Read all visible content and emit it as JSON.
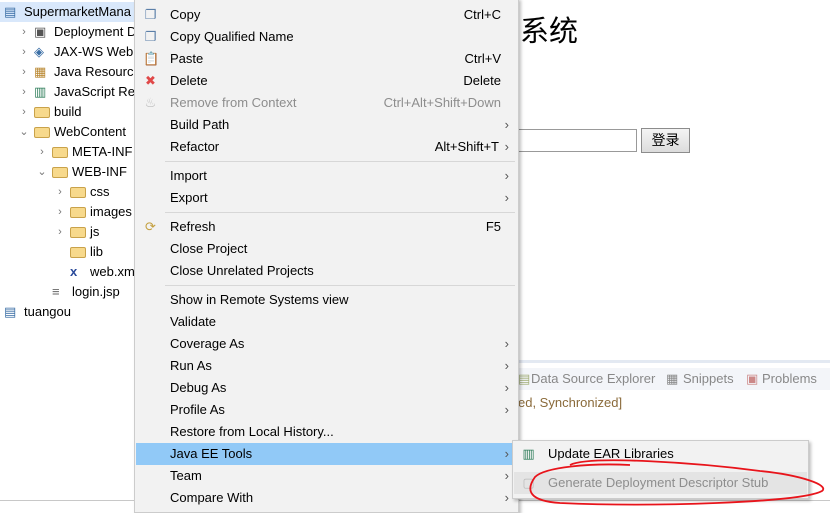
{
  "tree": {
    "items": [
      {
        "label": "SupermarketMana",
        "depth": 0,
        "twisty": "",
        "icon": "project-icon",
        "selected": true
      },
      {
        "label": "Deployment De",
        "depth": 1,
        "twisty": ">",
        "icon": "deployment-descriptor-icon"
      },
      {
        "label": "JAX-WS Web S",
        "depth": 1,
        "twisty": ">",
        "icon": "web-services-icon"
      },
      {
        "label": "Java Resources",
        "depth": 1,
        "twisty": ">",
        "icon": "java-resources-icon"
      },
      {
        "label": "JavaScript Resc",
        "depth": 1,
        "twisty": ">",
        "icon": "javascript-resources-icon"
      },
      {
        "label": "build",
        "depth": 1,
        "twisty": ">",
        "icon": "folder-icon"
      },
      {
        "label": "WebContent",
        "depth": 1,
        "twisty": "v",
        "icon": "folder-icon"
      },
      {
        "label": "META-INF",
        "depth": 2,
        "twisty": ">",
        "icon": "folder-icon"
      },
      {
        "label": "WEB-INF",
        "depth": 2,
        "twisty": "v",
        "icon": "folder-icon"
      },
      {
        "label": "css",
        "depth": 3,
        "twisty": ">",
        "icon": "folder-icon"
      },
      {
        "label": "images",
        "depth": 3,
        "twisty": ">",
        "icon": "folder-icon"
      },
      {
        "label": "js",
        "depth": 3,
        "twisty": ">",
        "icon": "folder-icon"
      },
      {
        "label": "lib",
        "depth": 3,
        "twisty": "",
        "icon": "folder-icon"
      },
      {
        "label": "web.xml",
        "depth": 3,
        "twisty": "",
        "icon": "xml-file-icon"
      },
      {
        "label": "login.jsp",
        "depth": 2,
        "twisty": "",
        "icon": "jsp-file-icon"
      },
      {
        "label": "tuangou",
        "depth": 0,
        "twisty": "",
        "icon": "project-warning-icon"
      }
    ]
  },
  "editor": {
    "title": "系统",
    "login_button": "登录",
    "username_value": ""
  },
  "panel": {
    "tabs": [
      "Data Source Explorer",
      "Snippets",
      "Problems"
    ],
    "status": "ed, Synchronized]"
  },
  "menu": {
    "items": [
      {
        "label": "Copy",
        "shortcut": "Ctrl+C",
        "icon": "copy-icon"
      },
      {
        "label": "Copy Qualified Name",
        "shortcut": "",
        "icon": "copy-qualified-name-icon"
      },
      {
        "label": "Paste",
        "shortcut": "Ctrl+V",
        "icon": "paste-icon"
      },
      {
        "label": "Delete",
        "shortcut": "Delete",
        "icon": "delete-icon"
      },
      {
        "label": "Remove from Context",
        "shortcut": "Ctrl+Alt+Shift+Down",
        "icon": "remove-context-icon",
        "disabled": true
      },
      {
        "label": "Build Path",
        "submenu": true
      },
      {
        "label": "Refactor",
        "shortcut": "Alt+Shift+T",
        "submenu": true
      },
      {
        "sep": true
      },
      {
        "label": "Import",
        "submenu": true
      },
      {
        "label": "Export",
        "submenu": true
      },
      {
        "sep": true
      },
      {
        "label": "Refresh",
        "shortcut": "F5",
        "icon": "refresh-icon"
      },
      {
        "label": "Close Project"
      },
      {
        "label": "Close Unrelated Projects"
      },
      {
        "sep": true
      },
      {
        "label": "Show in Remote Systems view"
      },
      {
        "label": "Validate"
      },
      {
        "label": "Coverage As",
        "submenu": true
      },
      {
        "label": "Run As",
        "submenu": true
      },
      {
        "label": "Debug As",
        "submenu": true
      },
      {
        "label": "Profile As",
        "submenu": true
      },
      {
        "label": "Restore from Local History..."
      },
      {
        "label": "Java EE Tools",
        "submenu": true,
        "highlighted": true
      },
      {
        "label": "Team",
        "submenu": true
      },
      {
        "label": "Compare With",
        "submenu": true
      }
    ]
  },
  "submenu": {
    "items": [
      {
        "label": "Update EAR Libraries",
        "icon": "ear-libraries-icon"
      },
      {
        "label": "Generate Deployment Descriptor Stub",
        "icon": "descriptor-stub-icon",
        "disabled": true,
        "hovered": true
      }
    ]
  },
  "colors": {
    "highlight": "#91c9f7",
    "annotation": "#e8141b",
    "status_text": "#8a6a3a"
  }
}
